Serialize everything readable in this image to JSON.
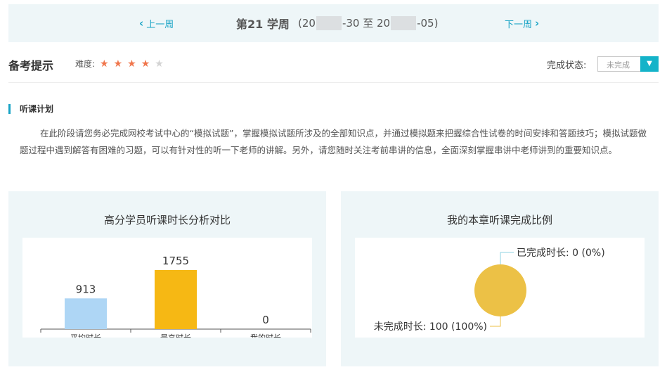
{
  "week_nav": {
    "prev_label": "上一周",
    "next_label": "下一周",
    "title": "第21 学周",
    "range_open": "(20",
    "range_mid": "-30 至 20",
    "range_close": "-05)"
  },
  "tips": {
    "title": "备考提示",
    "difficulty_label": "难度:",
    "difficulty_stars": 4,
    "difficulty_max": 5,
    "status_label": "完成状态:",
    "status_value": "未完成"
  },
  "plan": {
    "heading": "听课计划",
    "text": "在此阶段请您务必完成网校考试中心的“模拟试题”，掌握模拟试题所涉及的全部知识点，并通过模拟题来把握综合性试卷的时间安排和答题技巧；模拟试题做题过程中遇到解答有困难的习题，可以有针对性的听一下老师的讲解。另外，请您随时关注考前串讲的信息，全面深刻掌握串讲中老师讲到的重要知识点。"
  },
  "colors": {
    "accent": "#17a3c5",
    "star_on": "#f0764c",
    "star_off": "#d3d3d3",
    "bar_avg": "#aed6f5",
    "bar_max": "#f6b814",
    "pie": "#ecc146",
    "panel_bg": "#eef6f8"
  },
  "left_panel": {
    "title": "高分学员听课时长分析对比"
  },
  "right_panel": {
    "title": "我的本章听课完成比例"
  },
  "chart_data": [
    {
      "type": "bar",
      "title": "高分学员听课时长分析对比",
      "categories": [
        "平均时长",
        "最高时长",
        "我的时长"
      ],
      "values": [
        913,
        1755,
        0
      ],
      "data_labels": [
        "913",
        "1755",
        "0"
      ],
      "colors": [
        "#aed6f5",
        "#f6b814",
        "#aed6f5"
      ],
      "ylim": [
        0,
        1755
      ],
      "grid": false
    },
    {
      "type": "pie",
      "title": "我的本章听课完成比例",
      "slices": [
        {
          "label": "已完成时长",
          "value": 0,
          "display": "已完成时长: 0 (0%)"
        },
        {
          "label": "未完成时长",
          "value": 100,
          "display": "未完成时长: 100 (100%)"
        }
      ],
      "color": "#ecc146"
    }
  ]
}
